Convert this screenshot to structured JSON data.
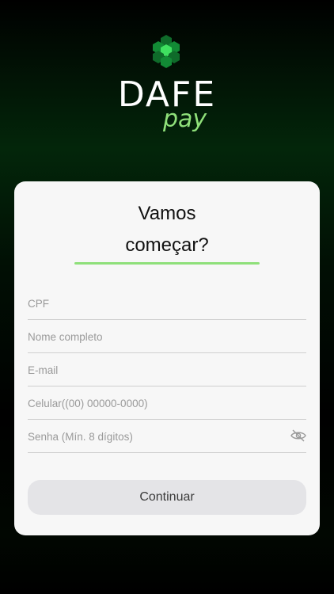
{
  "brand": {
    "name": "DAFE",
    "sub": "pay",
    "logo_icon": "hexagon-cluster-logo"
  },
  "card": {
    "title_line1": "Vamos",
    "title_line2": "começar?"
  },
  "form": {
    "cpf_placeholder": "CPF",
    "name_placeholder": "Nome completo",
    "email_placeholder": "E-mail",
    "phone_placeholder": "Celular((00) 00000-0000)",
    "password_placeholder": "Senha (Mín. 8 dígitos)",
    "password_toggle_icon": "eye-off-icon",
    "submit_label": "Continuar"
  },
  "colors": {
    "accent": "#8fe07a",
    "card_bg": "#f7f7f7",
    "button_bg": "#e4e4e7"
  }
}
